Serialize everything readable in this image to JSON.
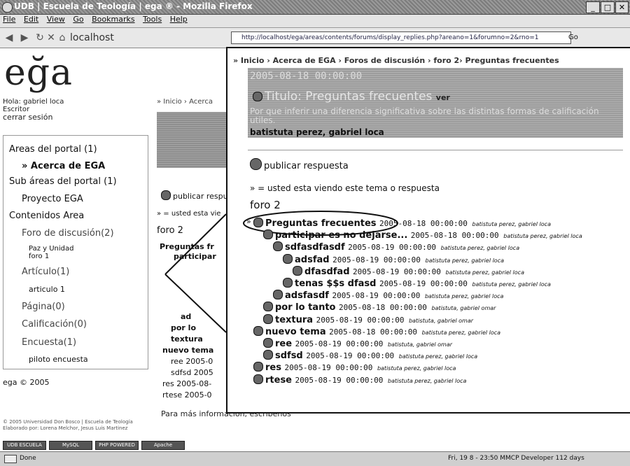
{
  "window": {
    "title": "UDB | Escuela de Teología | ega ® - Mozilla Firefox",
    "menu": [
      "File",
      "Edit",
      "View",
      "Go",
      "Bookmarks",
      "Tools",
      "Help"
    ],
    "localhost": "localhost",
    "url": "http://localhost/ega/areas/contents/forums/display_replies.php?areano=1&forumno=2&rno=1",
    "go_label": "Go",
    "status": "Done",
    "status_right": "Fri, 19 8 - 23:50   MMCP Developer 112 days"
  },
  "page": {
    "logo": "eğa",
    "greeting": "Hola: gabriel loca",
    "role": "Escritor",
    "logout": "cerrar sesión",
    "copyright": "ega © 2005",
    "sidebar": [
      {
        "label": "Areas del portal (1)"
      },
      {
        "label": "» Acerca de EGA"
      },
      {
        "label": "Sub áreas del portal (1)"
      },
      {
        "label": "Proyecto EGA"
      },
      {
        "label": "Contenidos Area"
      },
      {
        "label": "Foro de discusión(2)"
      },
      {
        "label": "Paz y Unidad"
      },
      {
        "label": "foro 1"
      },
      {
        "label": "Artículo(1)"
      },
      {
        "label": "articulo 1"
      },
      {
        "label": "Página(0)"
      },
      {
        "label": "Calificación(0)"
      },
      {
        "label": "Encuesta(1)"
      },
      {
        "label": "piloto encuesta"
      }
    ],
    "bg_breadcrumb": "» Inicio › Acerca",
    "bg_publish": "publicar respu",
    "bg_legend": "» = usted esta vie",
    "bg_forum": "foro 2",
    "bg_items": [
      "Preguntas fr",
      "participar",
      "ad",
      "por lo",
      "textura",
      "nuevo tema",
      "ree 2005-0",
      "sdfsd 2005",
      "res 2005-08-",
      "rtese 2005-0"
    ],
    "footer_info": "Para más información, escribenos",
    "footer_line1": "© 2005 Universidad Don Bosco | Escuela de Teología",
    "footer_line2": "Elaborado por: Lorena Melchor, Jesus Luis Martinez"
  },
  "zoom": {
    "breadcrumb": "» Inicio › Acerca de EGA › Foros de discusión › foro 2› Preguntas frecuentes",
    "date": "2005-08-18 00:00:00",
    "title": "Titulo: Preguntas frecuentes",
    "ver": "ver",
    "description": "Por que inferir una diferencia significativa sobre las distintas formas de calificación utiles.",
    "authors": "batistuta perez, gabriel loca",
    "publish": "publicar respuesta",
    "legend": "» = usted esta viendo este tema o respuesta",
    "forum": "foro 2",
    "items": [
      {
        "title": "Preguntas frecuentes",
        "date": "2005-08-18 00:00:00",
        "by": "batistuta perez, gabriel loca",
        "level": 0,
        "current": true
      },
      {
        "title": "participar es no dejarse...",
        "date": "2005-08-18 00:00:00",
        "by": "batistuta perez, gabriel loca",
        "level": 1
      },
      {
        "title": "sdfasdfasdf",
        "date": "2005-08-19 00:00:00",
        "by": "batistuta perez, gabriel loca",
        "level": 2
      },
      {
        "title": "adsfad",
        "date": "2005-08-19 00:00:00",
        "by": "batistuta perez, gabriel loca",
        "level": 3
      },
      {
        "title": "dfasdfad",
        "date": "2005-08-19 00:00:00",
        "by": "batistuta perez, gabriel loca",
        "level": 4
      },
      {
        "title": "tenas $$s dfasd",
        "date": "2005-08-19 00:00:00",
        "by": "batistuta perez, gabriel loca",
        "level": 3
      },
      {
        "title": "adsfasdf",
        "date": "2005-08-19 00:00:00",
        "by": "batistuta perez, gabriel loca",
        "level": 2
      },
      {
        "title": "por lo tanto",
        "date": "2005-08-18 00:00:00",
        "by": "batistuta, gabriel omar",
        "level": 1
      },
      {
        "title": "textura",
        "date": "2005-08-19 00:00:00",
        "by": "batistuta, gabriel omar",
        "level": 1
      },
      {
        "title": "nuevo tema",
        "date": "2005-08-18 00:00:00",
        "by": "batistuta perez, gabriel loca",
        "level": 0
      },
      {
        "title": "ree",
        "date": "2005-08-19 00:00:00",
        "by": "batistuta, gabriel omar",
        "level": 1
      },
      {
        "title": "sdfsd",
        "date": "2005-08-19 00:00:00",
        "by": "batistuta perez, gabriel loca",
        "level": 1
      },
      {
        "title": "res",
        "date": "2005-08-19 00:00:00",
        "by": "batistuta perez, gabriel loca",
        "level": 0
      },
      {
        "title": "rtese",
        "date": "2005-08-19 00:00:00",
        "by": "batistuta perez, gabriel loca",
        "level": 0
      }
    ]
  },
  "badges": [
    "UDB ESCUELA",
    "MySQL POWERED",
    "PHP POWERED",
    "Apache POWERED"
  ]
}
